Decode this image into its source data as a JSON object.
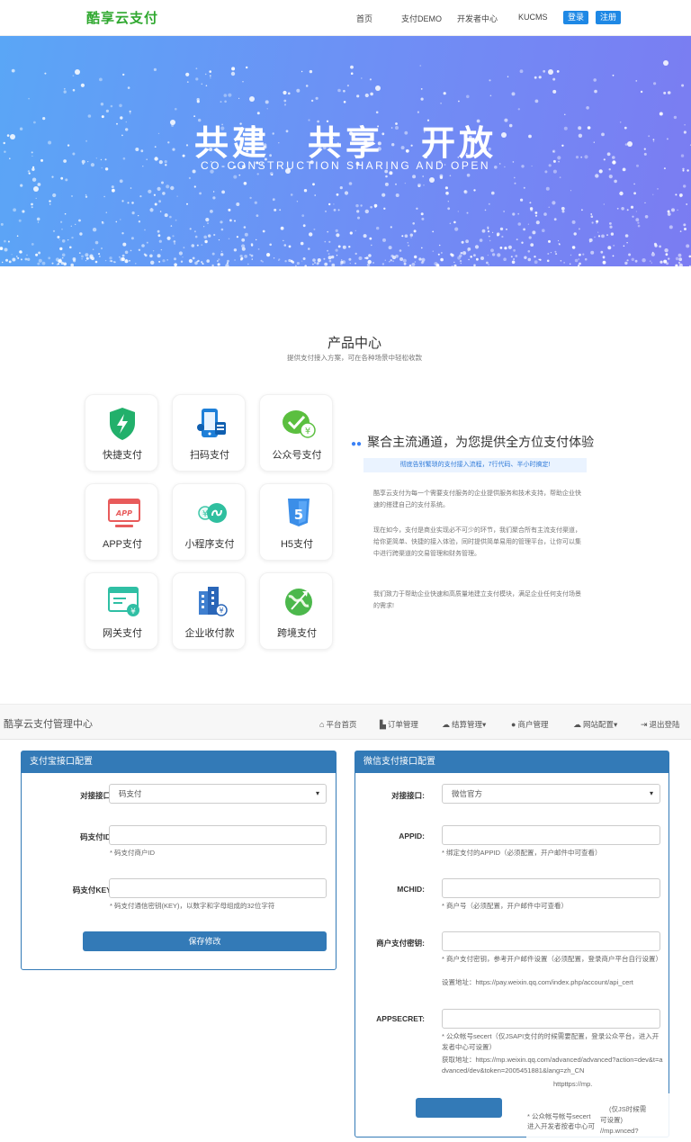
{
  "site": {
    "logo": "酷享云支付",
    "nav": [
      "首页",
      "支付DEMO",
      "开发者中心",
      "KUCMS"
    ],
    "login": "登录",
    "register": "注册"
  },
  "hero": {
    "title": "共建　共享　开放",
    "subtitle": "CO-CONSTRUCTION SHARING AND OPEN"
  },
  "products": {
    "title": "产品中心",
    "subtitle": "提供支付接入方案，可在各种场景中轻松收款",
    "items": [
      {
        "label": "快捷支付",
        "icon": "shield-lightning-icon"
      },
      {
        "label": "扫码支付",
        "icon": "phone-scan-icon"
      },
      {
        "label": "公众号支付",
        "icon": "wechat-pay-icon"
      },
      {
        "label": "APP支付",
        "icon": "app-window-icon"
      },
      {
        "label": "小程序支付",
        "icon": "mini-program-icon"
      },
      {
        "label": "H5支付",
        "icon": "html5-icon"
      },
      {
        "label": "网关支付",
        "icon": "gateway-icon"
      },
      {
        "label": "企业收付款",
        "icon": "enterprise-building-icon"
      },
      {
        "label": "跨境支付",
        "icon": "cross-border-icon"
      }
    ],
    "feature": {
      "heading": "聚合主流通道，为您提供全方位支付体验",
      "banner": "彻底告别繁琐的支付接入流程，7行代码、半小时搞定!",
      "paragraphs": [
        "酷享云支付为每一个需要支付服务的企业提供服务和技术支持，帮助企业快速的搭建自己的支付系统。",
        "现在如今，支付是商业实现必不可少的环节，我们聚合所有主流支付渠道，给你更简单、快捷的接入体验，同时提供简单易用的管理平台，让你可以集中进行跨渠道的交易管理和财务管理。",
        "我们致力于帮助企业快速和高质量地建立支付模块，满足企业任何支付场景的需求!"
      ]
    }
  },
  "admin": {
    "brand": "酷享云支付管理中心",
    "menu": [
      {
        "icon": "home-icon",
        "glyph": "⌂",
        "label": "平台首页"
      },
      {
        "icon": "cart-icon",
        "glyph": "🛒",
        "label": "订单管理"
      },
      {
        "icon": "cloud-icon",
        "glyph": "☁",
        "label": "结算管理▾"
      },
      {
        "icon": "user-icon",
        "glyph": "👤",
        "label": "商户管理"
      },
      {
        "icon": "cloud-icon",
        "glyph": "☁",
        "label": "网站配置▾"
      },
      {
        "icon": "logout-icon",
        "glyph": "⇥",
        "label": "退出登陆"
      }
    ],
    "alipay": {
      "title": "支付宝接口配置",
      "iface_label": "对接接口:",
      "iface_value": "码支付",
      "id_label": "码支付ID:",
      "id_help": "* 码支付商户ID",
      "key_label": "码支付KEY:",
      "key_help": "* 码支付通信密钥(KEY)，以数字和字母组成的32位字符",
      "save": "保存修改"
    },
    "wechat": {
      "title": "微信支付接口配置",
      "iface_label": "对接接口:",
      "iface_value": "微信官方",
      "appid_label": "APPID:",
      "appid_help": "* 绑定支付的APPID（必须配置，开户邮件中可查看）",
      "mchid_label": "MCHID:",
      "mchid_help": "* 商户号（必须配置，开户邮件中可查看）",
      "key_label": "商户支付密钥:",
      "key_help1": "* 商户支付密钥，参考开户邮件设置（必须配置，登录商户平台自行设置）",
      "key_help2": "设置地址：https://pay.weixin.qq.com/index.php/account/api_cert",
      "secret_label": "APPSECRET:",
      "secret_help1": "* 公众帐号secert（仅JSAPI支付的时候需要配置，登录公众平台，进入开发者中心可设置）",
      "secret_help2": "获取地址：https://mp.weixin.qq.com/advanced/advanced?action=dev&t=advanced/dev&token=2005451881&lang=zh_CN",
      "secret_help3": "httpttps://mp.",
      "ghost1": "* 公众帐号帐号secert",
      "ghost2": "进入开发者按者中心可",
      "ghost3": "(仅JS时候需",
      "ghost4": "可设置)",
      "ghost5": "//mp.wnced?"
    }
  }
}
